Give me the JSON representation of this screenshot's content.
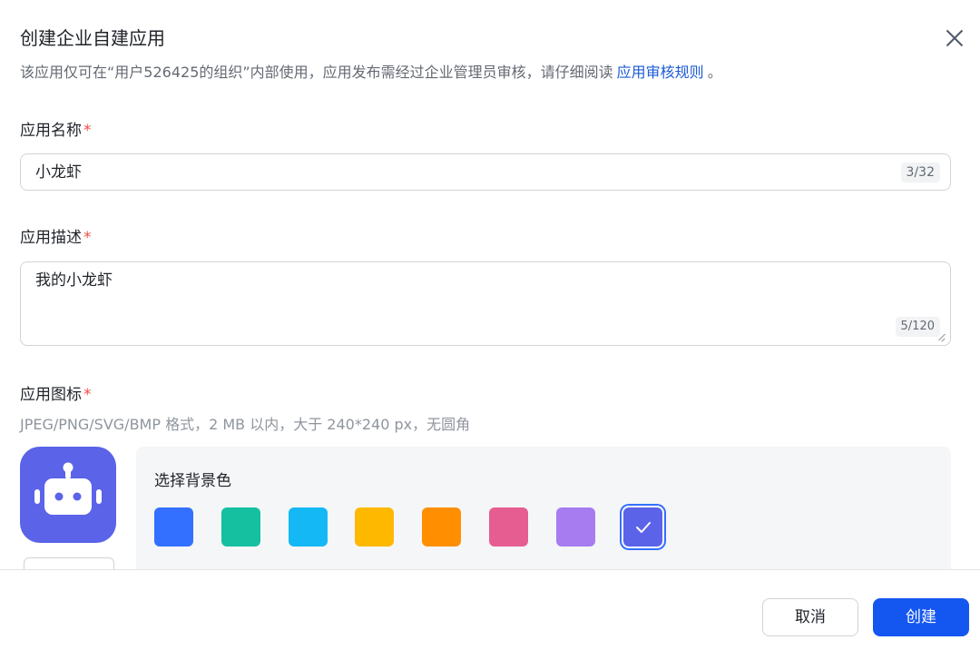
{
  "dialog": {
    "title": "创建企业自建应用",
    "subtitle_text": "该应用仅可在“用户526425的组织”内部使用，应用发布需经过企业管理员审核，请仔细阅读",
    "subtitle_link": "应用审核规则",
    "subtitle_end": "。",
    "close_icon": "close-icon"
  },
  "fields": {
    "name": {
      "label": "应用名称",
      "required_mark": "*",
      "value": "小龙虾",
      "counter": "3/32"
    },
    "description": {
      "label": "应用描述",
      "required_mark": "*",
      "value": "我的小龙虾",
      "counter": "5/120"
    },
    "icon": {
      "label": "应用图标",
      "required_mark": "*",
      "hint": "JPEG/PNG/SVG/BMP 格式，2 MB 以内，大于 240*240 px，无圆角",
      "icon_name": "robot-icon",
      "icon_bg": "#5b63e8"
    }
  },
  "color_picker": {
    "title": "选择背景色",
    "swatches": [
      {
        "color": "#3370ff",
        "selected": false
      },
      {
        "color": "#14c0a0",
        "selected": false
      },
      {
        "color": "#14b8f5",
        "selected": false
      },
      {
        "color": "#ffb800",
        "selected": false
      },
      {
        "color": "#ff8f00",
        "selected": false
      },
      {
        "color": "#e65d92",
        "selected": false
      },
      {
        "color": "#a77cf0",
        "selected": false
      },
      {
        "color": "#5b63e8",
        "selected": true
      }
    ]
  },
  "footer": {
    "cancel_label": "取消",
    "create_label": "创建",
    "primary_color": "#1456f0"
  }
}
